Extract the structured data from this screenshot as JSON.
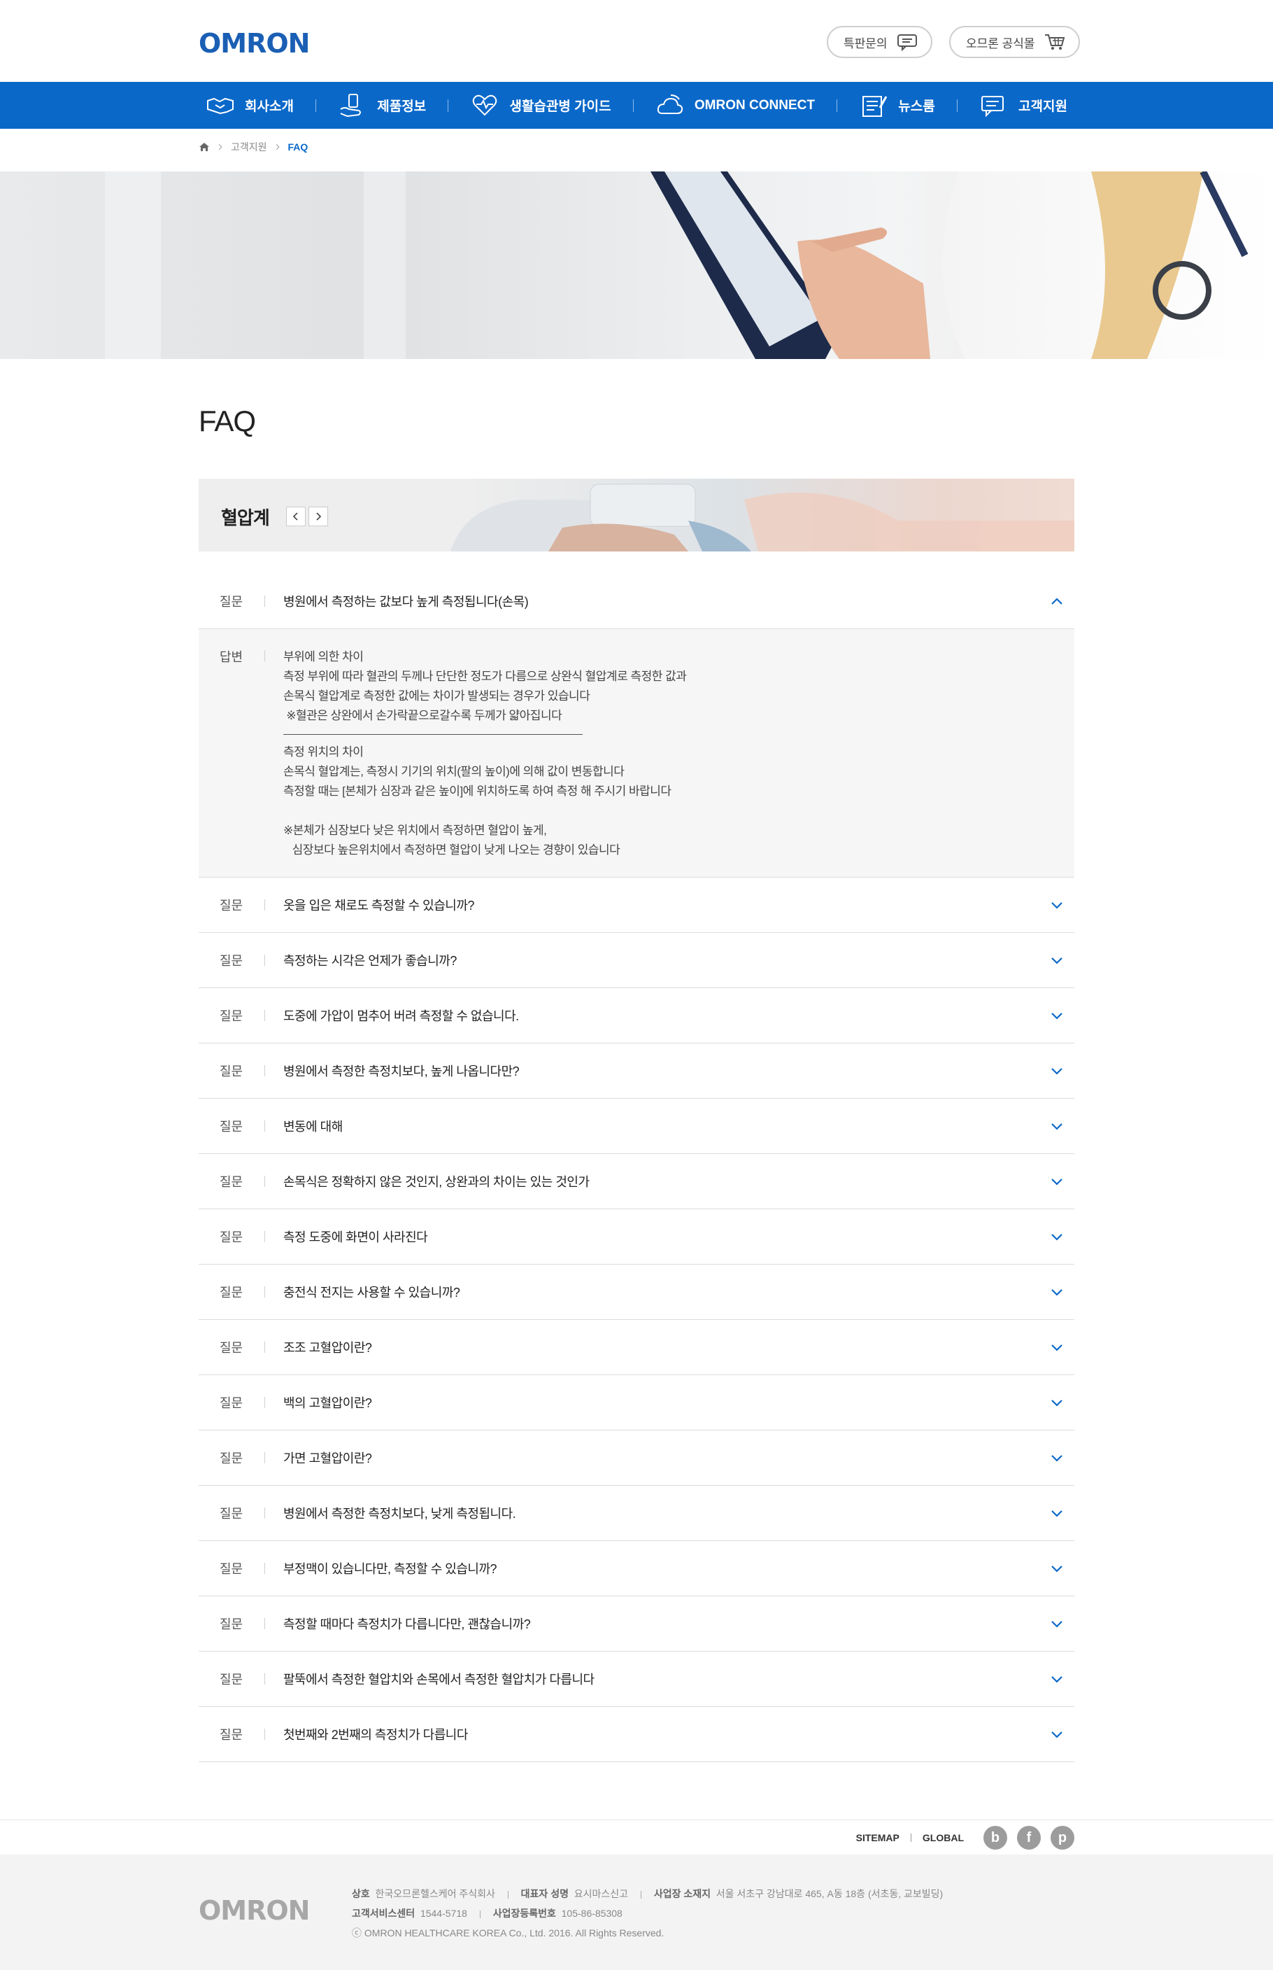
{
  "header": {
    "logo": "OMRON",
    "inquiry_btn": "특판문의",
    "mall_btn": "오므론 공식몰"
  },
  "nav": {
    "items": [
      {
        "label": "회사소개",
        "icon": "handshake-icon"
      },
      {
        "label": "제품정보",
        "icon": "hand-device-icon"
      },
      {
        "label": "생활습관병 가이드",
        "icon": "heart-care-icon"
      },
      {
        "label": "OMRON CONNECT",
        "icon": "cloud-icon"
      },
      {
        "label": "뉴스룸",
        "icon": "news-icon"
      },
      {
        "label": "고객지원",
        "icon": "support-chat-icon"
      }
    ]
  },
  "breadcrumb": {
    "home_icon": "home-icon",
    "level1": "고객지원",
    "current": "FAQ"
  },
  "page": {
    "title": "FAQ",
    "category": "혈압계"
  },
  "faq": {
    "q_label": "질문",
    "a_label": "답변",
    "open_question": "병원에서 측정하는 값보다 높게 측정됩니다(손목)",
    "answer": {
      "p1": [
        "부위에 의한 차이",
        "측정 부위에 따라 혈관의 두께나 단단한 정도가 다름으로 상완식 혈압계로 측정한 값과",
        "손목식 혈압계로 측정한 값에는 차이가 발생되는 경우가 있습니다",
        " ※혈관은 상완에서 손가락끝으로갈수록 두께가 얇아집니다"
      ],
      "p2": [
        "측정 위치의 차이",
        "손목식 혈압계는, 측정시 기기의 위치(팔의 높이)에 의해 값이 변동합니다",
        "측정할 때는 [본체가 심장과 같은 높이]에 위치하도록 하여 측정 해 주시기 바랍니다"
      ],
      "p3": [
        "※본체가 심장보다 낮은 위치에서 측정하면 혈압이 높게,",
        "   심장보다 높은위치에서 측정하면 혈압이 낮게 나오는 경향이 있습니다"
      ]
    },
    "questions": [
      "옷을 입은 채로도 측정할 수 있습니까?",
      "측정하는 시각은 언제가 좋습니까?",
      "도중에 가압이 멈추어 버려 측정할 수 없습니다.",
      "병원에서 측정한 측정치보다, 높게 나옵니다만?",
      "변동에 대해",
      "손목식은 정확하지 않은 것인지, 상완과의 차이는 있는 것인가",
      "측정 도중에 화면이 사라진다",
      "충전식 전지는 사용할 수 있습니까?",
      "조조 고혈압이란?",
      "백의 고혈압이란?",
      "가면 고혈압이란?",
      "병원에서 측정한 측정치보다, 낮게 측정됩니다.",
      "부정맥이 있습니다만, 측정할 수 있습니까?",
      "측정할 때마다 측정치가 다릅니다만, 괜찮습니까?",
      "팔뚝에서 측정한 혈압치와 손목에서 측정한 혈압치가 다릅니다",
      "첫번째와 2번째의 측정치가 다릅니다"
    ]
  },
  "footer": {
    "sitemap": "SITEMAP",
    "global": "GLOBAL",
    "sns": [
      "b",
      "f",
      "p"
    ],
    "logo": "OMRON",
    "company_label": "상호",
    "company": "한국오므론헬스케어 주식회사",
    "ceo_label": "대표자 성명",
    "ceo": "요시마스신고",
    "address_label": "사업장 소재지",
    "address": "서울 서초구 강남대로 465, A동 18층 (서초동, 교보빌딩)",
    "service_label": "고객서비스센터",
    "service": "1544-5718",
    "bizno_label": "사업장등록번호",
    "bizno": "105-86-85308",
    "copyright": "ⓒ OMRON HEALTHCARE KOREA Co., Ltd. 2016. All Rights Reserved."
  }
}
